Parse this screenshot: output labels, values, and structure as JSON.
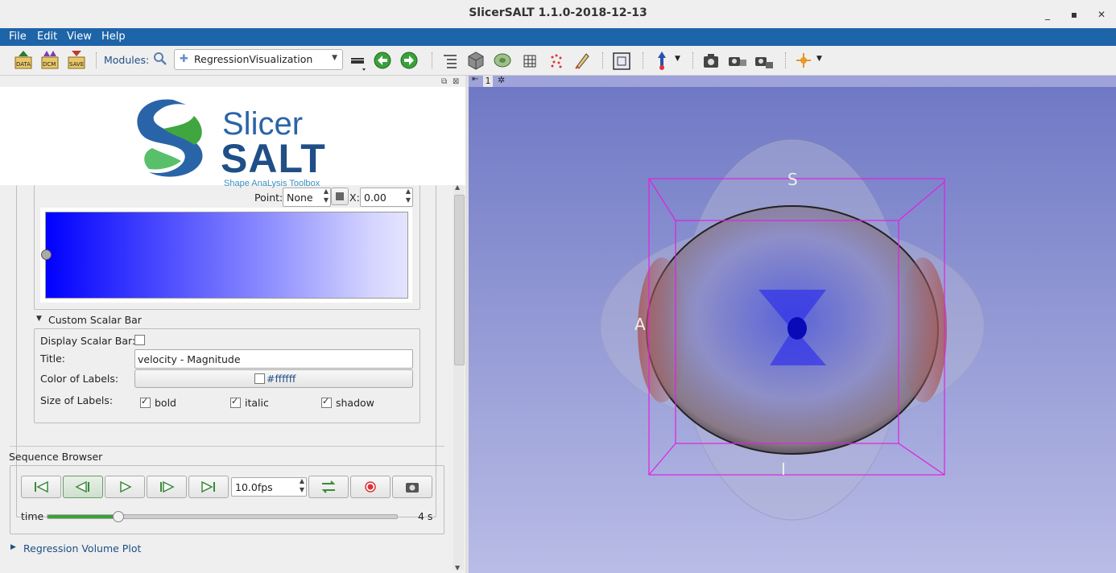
{
  "window": {
    "title": "SlicerSALT 1.1.0-2018-12-13",
    "min_icon": "minimize-icon",
    "max_icon": "maximize-icon",
    "close_icon": "close-icon"
  },
  "menu": {
    "file": "File",
    "edit": "Edit",
    "view": "View",
    "help": "Help"
  },
  "toolbar": {
    "data_label": "DATA",
    "dcm_label": "DCM",
    "save_label": "SAVE",
    "modules_label": "Modules:",
    "module_selected": "RegressionVisualization"
  },
  "logo": {
    "line1": "Slicer",
    "line2": "SALT",
    "tagline": "Shape AnaLysis Toolbox"
  },
  "colormap": {
    "point_label": "Point:",
    "point_value": "None",
    "x_label": "X:",
    "x_value": "0.00"
  },
  "scalar_bar": {
    "section": "Custom Scalar Bar",
    "display_label": "Display Scalar Bar:",
    "title_label": "Title:",
    "title_value": "velocity - Magnitude",
    "color_label": "Color of Labels:",
    "color_value": "#ffffff",
    "size_label": "Size of Labels:",
    "bold": "bold",
    "italic": "italic",
    "shadow": "shadow"
  },
  "sequence": {
    "section": "Sequence Browser",
    "fps": "10.0fps",
    "time_label": "time",
    "time_value": "4 s",
    "time_progress": 0.2
  },
  "regression_plot": "Regression Volume Plot",
  "view": {
    "index": "1",
    "label_s": "S",
    "label_i": "I",
    "label_a": "A"
  },
  "colors": {
    "menubar": "#1e64a8",
    "background_3d_top": "#6e77c4",
    "background_3d_bottom": "#b9bce6",
    "bbox": "#e020e0"
  }
}
